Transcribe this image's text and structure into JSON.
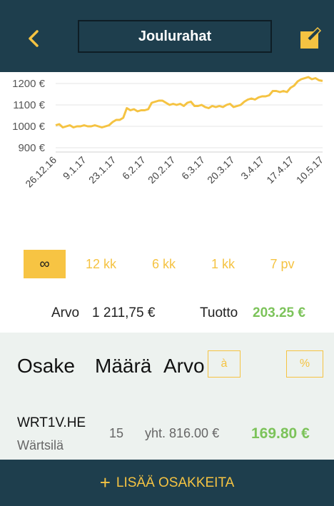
{
  "colors": {
    "header_bg": "#1e3e4d",
    "accent": "#f7c443",
    "gain": "#7cc35a",
    "panel_bg": "#edf2ef"
  },
  "header": {
    "title": "Joulurahat",
    "back_icon": "chevron-left-icon",
    "edit_icon": "edit-icon"
  },
  "chart_data": {
    "type": "line",
    "y_ticks": [
      "900 €",
      "1000 €",
      "1100 €",
      "1200 €"
    ],
    "y_tick_values": [
      900,
      1000,
      1100,
      1200
    ],
    "x_ticks": [
      "26.12.16",
      "9.1.17",
      "23.1.17",
      "6.2.17",
      "20.2.17",
      "6.3.17",
      "20.3.17",
      "3.4.17",
      "17.4.17",
      "10.5.17"
    ],
    "ylim": [
      880,
      1240
    ],
    "grid": true,
    "series": [
      {
        "color": "#f5c342",
        "values": [
          1005,
          1010,
          995,
          1000,
          1005,
          995,
          1000,
          1000,
          1005,
          1000,
          1000,
          1005,
          1000,
          995,
          1000,
          1005,
          1020,
          1030,
          1030,
          1040,
          1085,
          1075,
          1080,
          1070,
          1075,
          1075,
          1080,
          1110,
          1115,
          1120,
          1120,
          1110,
          1100,
          1105,
          1100,
          1105,
          1095,
          1110,
          1115,
          1095,
          1095,
          1100,
          1090,
          1085,
          1095,
          1090,
          1095,
          1090,
          1100,
          1105,
          1090,
          1095,
          1100,
          1115,
          1125,
          1130,
          1125,
          1135,
          1140,
          1140,
          1145,
          1165,
          1165,
          1160,
          1165,
          1160,
          1180,
          1190,
          1210,
          1220,
          1225,
          1230,
          1220,
          1225,
          1215,
          1212
        ]
      }
    ]
  },
  "range": {
    "options": [
      "∞",
      "12 kk",
      "6 kk",
      "1 kk",
      "7 pv"
    ],
    "selected_index": 0
  },
  "summary": {
    "value_label": "Arvo",
    "value": "1 211,75 €",
    "return_label": "Tuotto",
    "return_value": "203.25 €"
  },
  "table": {
    "col_stock": "Osake",
    "col_qty": "Määrä",
    "col_value": "Arvo",
    "toggle_unit": "à",
    "toggle_percent": "%"
  },
  "holdings": [
    {
      "ticker": "WRT1V.HE",
      "name": "Wärtsilä",
      "quantity": "15",
      "total": "yht. 816.00 €",
      "gain": "169.80 €"
    }
  ],
  "footer": {
    "add_icon": "plus-icon",
    "add_label": "LISÄÄ OSAKKEITA"
  }
}
